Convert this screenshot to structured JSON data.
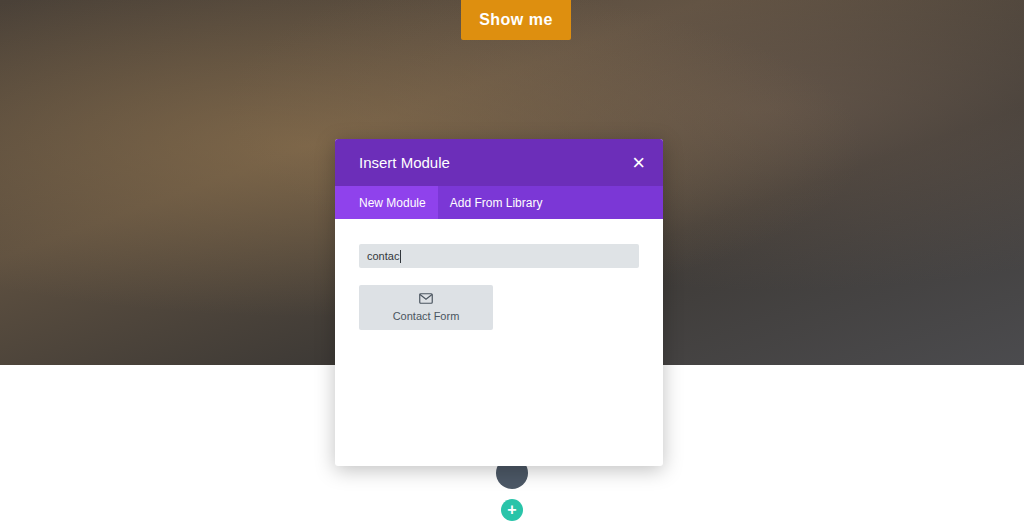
{
  "button": {
    "label": "Show me"
  },
  "modal": {
    "title": "Insert Module",
    "close": "×"
  },
  "tabs": [
    {
      "label": "New Module",
      "selected": true
    },
    {
      "label": "Add From Library",
      "selected": false
    }
  ],
  "search": {
    "value": "contac"
  },
  "modules": [
    {
      "label": "Contact Form"
    }
  ],
  "add_button": {
    "label": "+"
  }
}
